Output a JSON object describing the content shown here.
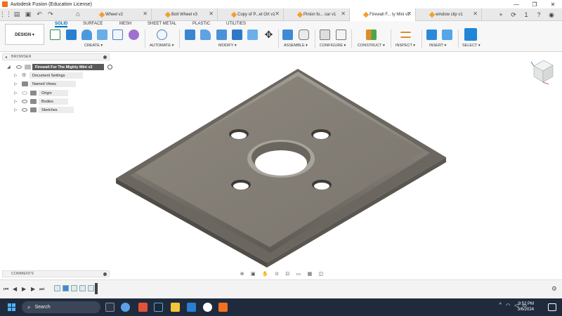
{
  "window": {
    "title": "Autodesk Fusion (Education License)",
    "minimize": "—",
    "maximize": "❐",
    "close": "✕"
  },
  "quick_access": {
    "grid_icon": "⋮⋮",
    "file_icon": "▤",
    "save_icon": "▣",
    "undo_icon": "↶",
    "redo_icon": "↷",
    "home_icon": "⌂"
  },
  "tabs": [
    {
      "label": "Wheel v2",
      "active": false
    },
    {
      "label": "Bolt Wheel v3",
      "active": false
    },
    {
      "label": "Copy of P...et Ort v1",
      "active": false
    },
    {
      "label": "Pinion fo... car v1",
      "active": false
    },
    {
      "label": "Firewall F... ty Mini v2",
      "active": true
    },
    {
      "label": "window clip v1",
      "active": false
    }
  ],
  "tab_close": "✕",
  "tabbar_right": {
    "add_tab": "+",
    "sync": "⟳",
    "jobs_count": "1",
    "help": "?",
    "account": "◉"
  },
  "toolbar": {
    "design_label": "DESIGN ▾",
    "subtabs": [
      "SOLID",
      "SURFACE",
      "MESH",
      "SHEET METAL",
      "PLASTIC",
      "UTILITIES"
    ],
    "groups": [
      "CREATE ▾",
      "AUTOMATE ▾",
      "MODIFY ▾",
      "ASSEMBLE ▾",
      "CONFIGURE ▾",
      "CONSTRUCT ▾",
      "INSPECT ▾",
      "INSERT ▾",
      "SELECT ▾"
    ]
  },
  "browser": {
    "header": "BROWSER",
    "collapse_icon": "◂",
    "root": "Firewall For The Mighty Mini v2",
    "items": [
      "Document Settings",
      "Named Views",
      "Origin",
      "Bodies",
      "Sketches"
    ]
  },
  "comments": {
    "header": "COMMENTS"
  },
  "navbar": {
    "orbit": "⊕",
    "look": "▣",
    "pan": "✋",
    "zoom": "⊙",
    "fit": "⊡",
    "display": "▭",
    "grid": "▦",
    "viewports": "◫"
  },
  "timeline": {
    "first": "⏮",
    "prev": "◀",
    "play": "▶",
    "next": "▶",
    "last": "⏭",
    "settings": "⚙"
  },
  "taskbar": {
    "search_icon": "⌕",
    "search": "Search",
    "tray": [
      "^",
      "◠",
      "◁",
      "▭"
    ],
    "time": "9:52 PM",
    "date": "3/6/2024"
  },
  "colors": {
    "accent": "#0070c0",
    "model_top": "#87827a",
    "model_edge": "#5f5a54",
    "taskbar": "#1f2a3c"
  }
}
